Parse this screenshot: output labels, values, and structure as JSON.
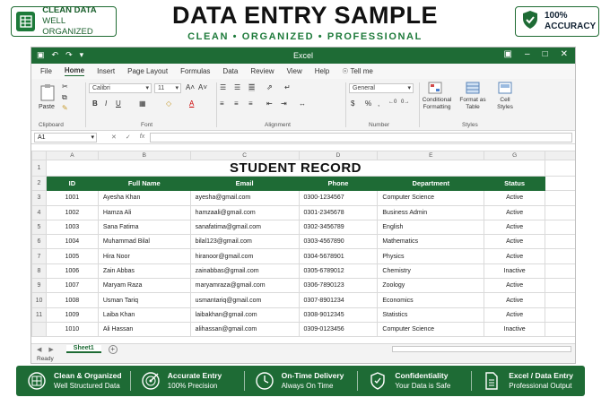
{
  "banner": {
    "left_badge": [
      "CLEAN DATA",
      "WELL ORGANIZED"
    ],
    "title": "DATA ENTRY SAMPLE",
    "subtitle": "CLEAN • ORGANIZED • PROFESSIONAL",
    "right_badge": [
      "100%",
      "ACCURACY"
    ]
  },
  "window": {
    "title": "Excel",
    "menu": [
      "File",
      "Home",
      "Insert",
      "Page Layout",
      "Formulas",
      "Data",
      "Review",
      "View",
      "Help"
    ],
    "tell_me": "Tell me",
    "ribbon": {
      "paste": "Paste",
      "clipboard": "Clipboard",
      "font_name": "Calibri",
      "font_size": "11",
      "font": "Font",
      "alignment": "Alignment",
      "number_format": "General",
      "number": "Number",
      "conditional": [
        "Conditional",
        "Formatting"
      ],
      "format_table": [
        "Format as",
        "Table"
      ],
      "cell_styles": [
        "Cell",
        "Styles"
      ],
      "styles": "Styles"
    },
    "name_box": "A1",
    "fx": "fx"
  },
  "sheet": {
    "columns": [
      "A",
      "B",
      "C",
      "D",
      "E",
      "G"
    ],
    "row_numbers": [
      "1",
      "2",
      "3",
      "4",
      "5",
      "6",
      "7",
      "8",
      "9",
      "10",
      "11"
    ],
    "title": "STUDENT RECORD",
    "headers": [
      "ID",
      "Full Name",
      "Email",
      "Phone",
      "Department",
      "Status"
    ],
    "rows": [
      [
        "1001",
        "Ayesha Khan",
        "ayesha@gmail.com",
        "0300-1234567",
        "Computer Science",
        "Active"
      ],
      [
        "1002",
        "Hamza Ali",
        "hamzaali@gmail.com",
        "0301-2345678",
        "Business Admin",
        "Active"
      ],
      [
        "1003",
        "Sana Fatima",
        "sanafatima@gmail.com",
        "0302-3456789",
        "English",
        "Active"
      ],
      [
        "1004",
        "Muhammad Bilal",
        "bilal123@gmail.com",
        "0303-4567890",
        "Mathematics",
        "Active"
      ],
      [
        "1005",
        "Hira Noor",
        "hiranoor@gmail.com",
        "0304-5678901",
        "Physics",
        "Active"
      ],
      [
        "1006",
        "Zain Abbas",
        "zainabbas@gmail.com",
        "0305-6789012",
        "Chemistry",
        "Inactive"
      ],
      [
        "1007",
        "Maryam Raza",
        "maryamraza@gmail.com",
        "0306-7890123",
        "Zoology",
        "Active"
      ],
      [
        "1008",
        "Usman Tariq",
        "usmantariq@gmail.com",
        "0307-8901234",
        "Economics",
        "Active"
      ],
      [
        "1009",
        "Laiba Khan",
        "laibakhan@gmail.com",
        "0308-9012345",
        "Statistics",
        "Active"
      ],
      [
        "1010",
        "Ali Hassan",
        "alihassan@gmail.com",
        "0309-0123456",
        "Computer Science",
        "Inactive"
      ]
    ],
    "tab": "Sheet1",
    "status": "Ready"
  },
  "footer": [
    {
      "title": "Clean & Organized",
      "sub": "Well Structured Data",
      "icon": "grid-icon"
    },
    {
      "title": "Accurate Entry",
      "sub": "100% Precision",
      "icon": "target-icon"
    },
    {
      "title": "On-Time Delivery",
      "sub": "Always On Time",
      "icon": "clock-icon"
    },
    {
      "title": "Confidentiality",
      "sub": "Your Data is Safe",
      "icon": "shield-icon"
    },
    {
      "title": "Excel / Data Entry",
      "sub": "Professional Output",
      "icon": "document-icon"
    }
  ],
  "colors": {
    "accent": "#1e6b35",
    "header_text": "#ffffff"
  }
}
